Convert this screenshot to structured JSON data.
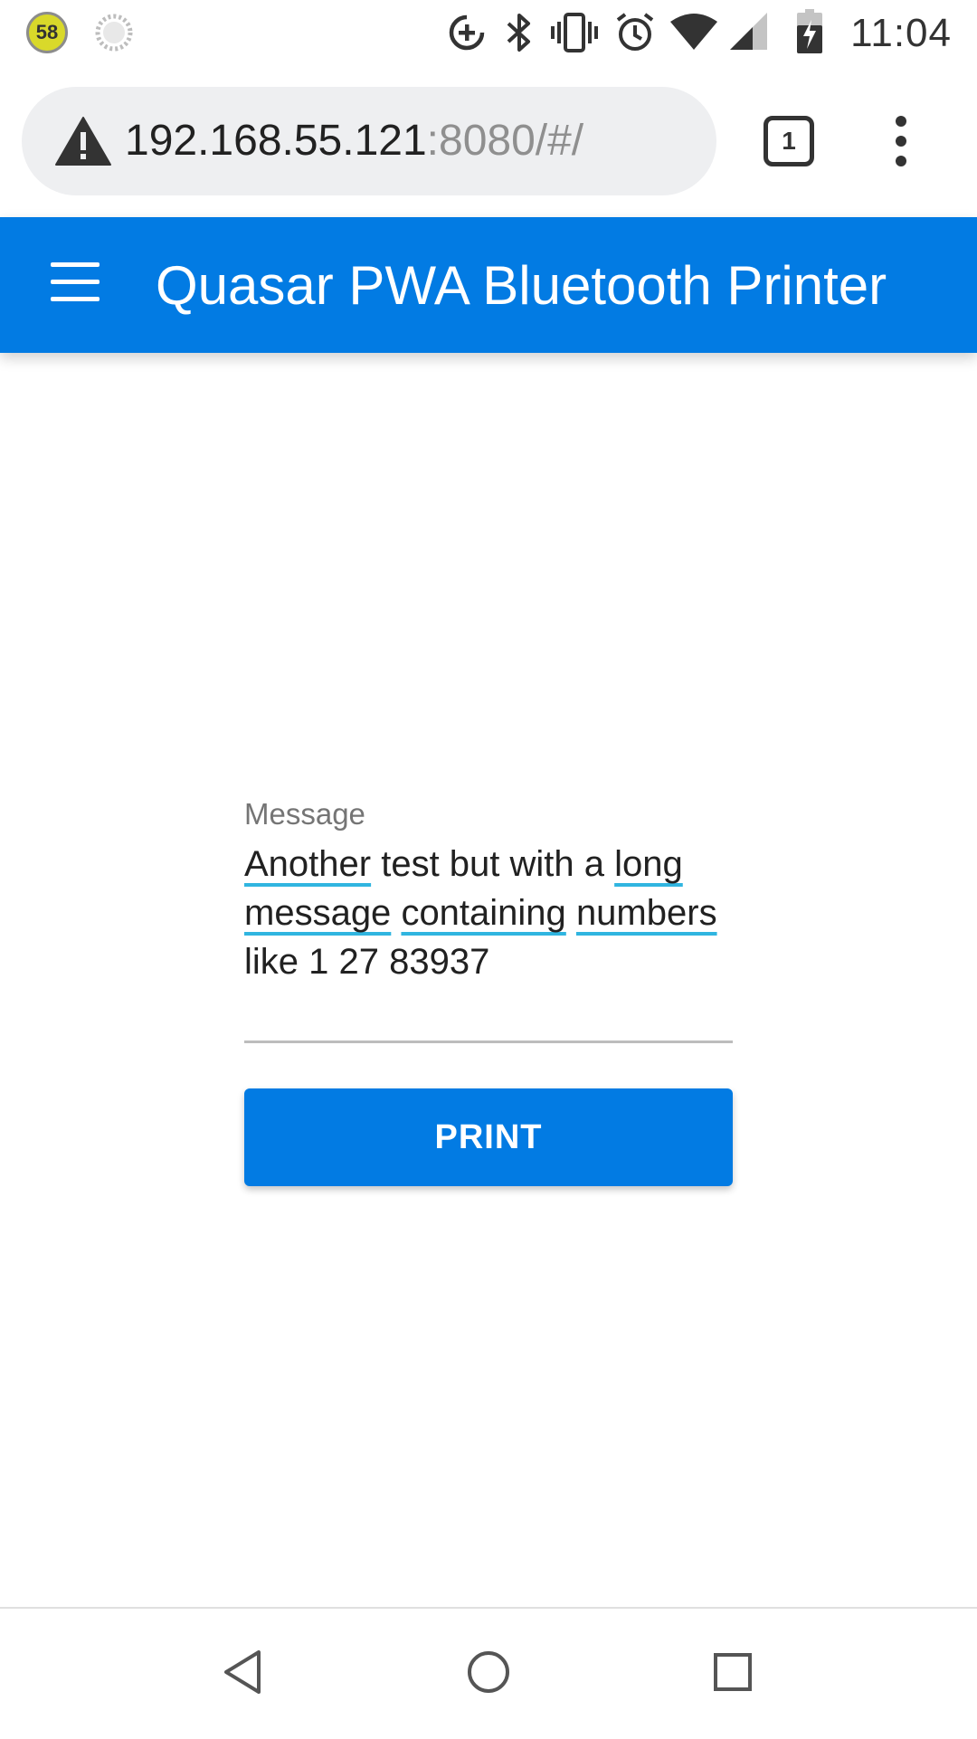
{
  "status_bar": {
    "notification_badge": "58",
    "time": "11:04",
    "icons": [
      "data-saver-icon",
      "bluetooth-icon",
      "vibrate-icon",
      "alarm-icon",
      "wifi-icon",
      "cell-signal-icon",
      "battery-charging-icon"
    ]
  },
  "browser": {
    "url_host": "192.168.55.121",
    "url_path": ":8080/#/",
    "tab_count": "1",
    "security_icon": "warning-icon"
  },
  "toolbar": {
    "title": "Quasar PWA Bluetooth Printer",
    "background_color": "#027be3"
  },
  "form": {
    "message_label": "Message",
    "message_words": [
      {
        "text": "Another",
        "spell": true
      },
      {
        "text": " test but with a ",
        "spell": false
      },
      {
        "text": "long",
        "spell": true
      },
      {
        "text": " ",
        "spell": false
      },
      {
        "text": "message",
        "spell": true
      },
      {
        "text": " ",
        "spell": false
      },
      {
        "text": "containing",
        "spell": true
      },
      {
        "text": " ",
        "spell": false
      },
      {
        "text": "numbers",
        "spell": true
      },
      {
        "text": " like 1 27 83937",
        "spell": false
      }
    ],
    "print_label": "PRINT",
    "accent_color": "#027be3"
  },
  "navigation": {
    "buttons": [
      "back-icon",
      "home-icon",
      "recents-icon"
    ]
  }
}
